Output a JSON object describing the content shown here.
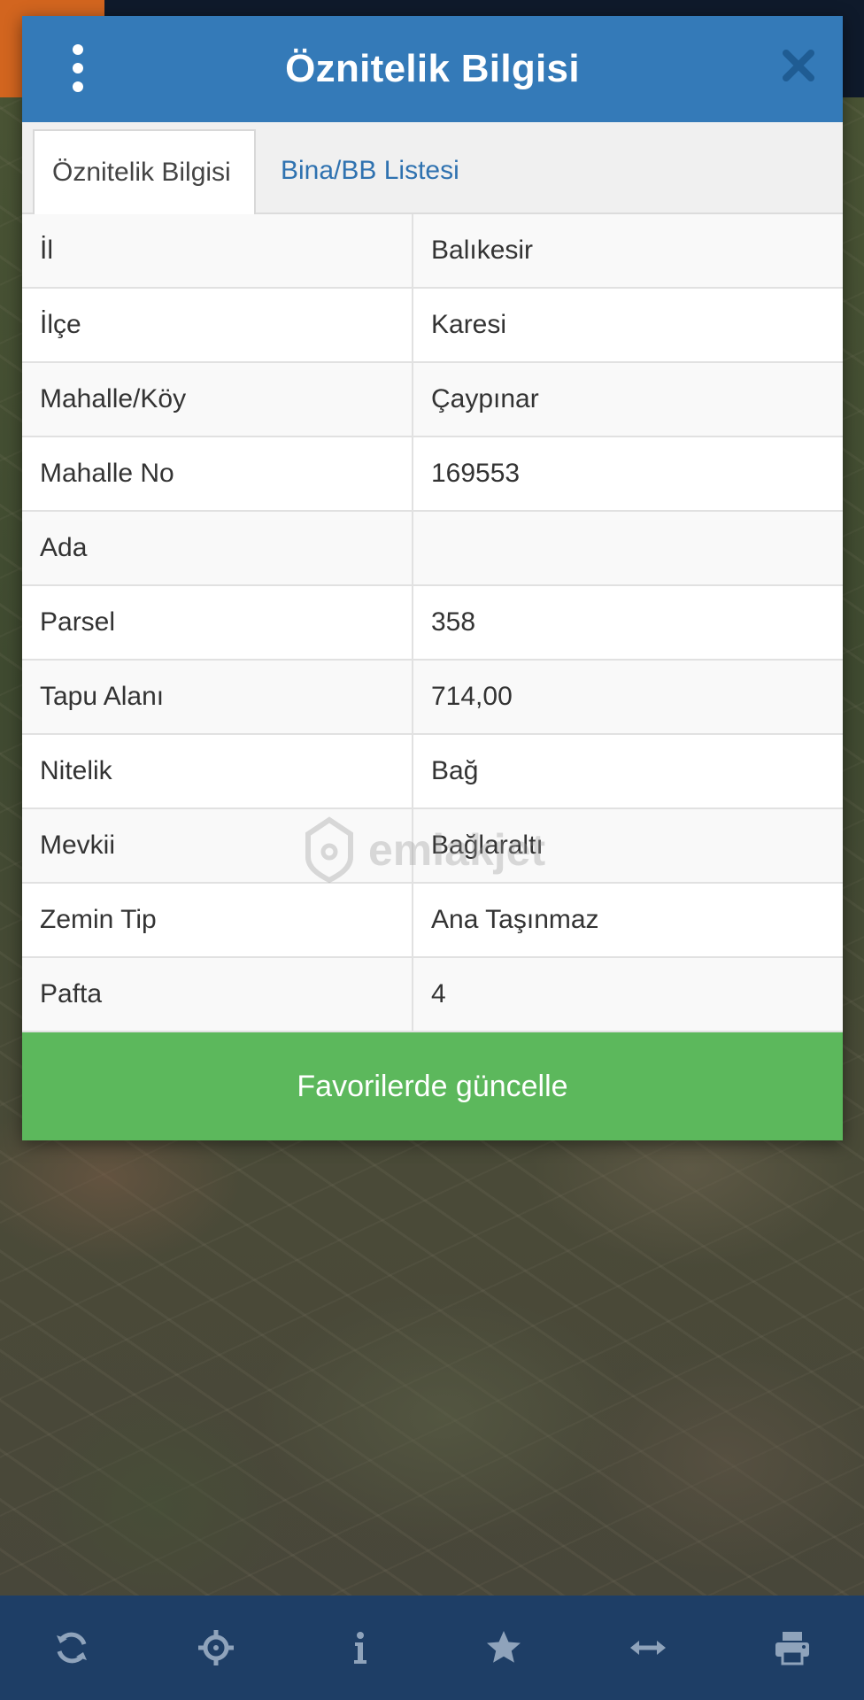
{
  "dialog": {
    "title": "Öznitelik Bilgisi",
    "tabs": [
      {
        "label": "Öznitelik Bilgisi",
        "active": true
      },
      {
        "label": "Bina/BB Listesi",
        "active": false
      }
    ],
    "rows": [
      {
        "key": "İl",
        "value": "Balıkesir"
      },
      {
        "key": "İlçe",
        "value": "Karesi"
      },
      {
        "key": "Mahalle/Köy",
        "value": "Çaypınar"
      },
      {
        "key": "Mahalle No",
        "value": "169553"
      },
      {
        "key": "Ada",
        "value": ""
      },
      {
        "key": "Parsel",
        "value": "358"
      },
      {
        "key": "Tapu Alanı",
        "value": "714,00"
      },
      {
        "key": "Nitelik",
        "value": "Bağ"
      },
      {
        "key": "Mevkii",
        "value": "Bağlaraltı"
      },
      {
        "key": "Zemin Tip",
        "value": "Ana Taşınmaz"
      },
      {
        "key": "Pafta",
        "value": "4"
      }
    ],
    "favorite_button_label": "Favorilerde güncelle"
  },
  "watermark": {
    "text": "emlakjet"
  },
  "toolbar": {
    "items": [
      {
        "icon": "refresh-icon"
      },
      {
        "icon": "crosshair-icon"
      },
      {
        "icon": "info-icon"
      },
      {
        "icon": "star-icon"
      },
      {
        "icon": "horizontal-arrows-icon"
      },
      {
        "icon": "print-icon"
      }
    ]
  },
  "colors": {
    "header": "#347ab8",
    "tab_link": "#2f72b0",
    "favorite_button": "#5cb85c",
    "toolbar": "#1e3e66",
    "toolbar_icon": "#8fa3bb"
  }
}
